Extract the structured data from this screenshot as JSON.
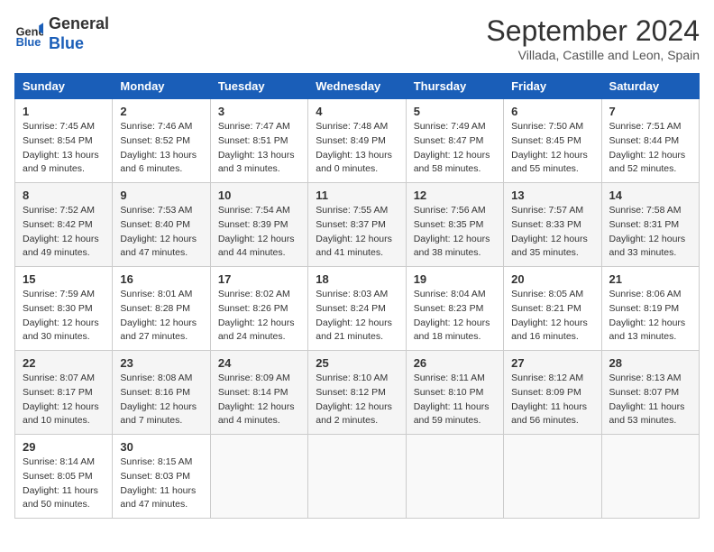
{
  "header": {
    "logo_line1": "General",
    "logo_line2": "Blue",
    "month_title": "September 2024",
    "location": "Villada, Castille and Leon, Spain"
  },
  "weekdays": [
    "Sunday",
    "Monday",
    "Tuesday",
    "Wednesday",
    "Thursday",
    "Friday",
    "Saturday"
  ],
  "weeks": [
    [
      {
        "day": "1",
        "sunrise": "Sunrise: 7:45 AM",
        "sunset": "Sunset: 8:54 PM",
        "daylight": "Daylight: 13 hours and 9 minutes."
      },
      {
        "day": "2",
        "sunrise": "Sunrise: 7:46 AM",
        "sunset": "Sunset: 8:52 PM",
        "daylight": "Daylight: 13 hours and 6 minutes."
      },
      {
        "day": "3",
        "sunrise": "Sunrise: 7:47 AM",
        "sunset": "Sunset: 8:51 PM",
        "daylight": "Daylight: 13 hours and 3 minutes."
      },
      {
        "day": "4",
        "sunrise": "Sunrise: 7:48 AM",
        "sunset": "Sunset: 8:49 PM",
        "daylight": "Daylight: 13 hours and 0 minutes."
      },
      {
        "day": "5",
        "sunrise": "Sunrise: 7:49 AM",
        "sunset": "Sunset: 8:47 PM",
        "daylight": "Daylight: 12 hours and 58 minutes."
      },
      {
        "day": "6",
        "sunrise": "Sunrise: 7:50 AM",
        "sunset": "Sunset: 8:45 PM",
        "daylight": "Daylight: 12 hours and 55 minutes."
      },
      {
        "day": "7",
        "sunrise": "Sunrise: 7:51 AM",
        "sunset": "Sunset: 8:44 PM",
        "daylight": "Daylight: 12 hours and 52 minutes."
      }
    ],
    [
      {
        "day": "8",
        "sunrise": "Sunrise: 7:52 AM",
        "sunset": "Sunset: 8:42 PM",
        "daylight": "Daylight: 12 hours and 49 minutes."
      },
      {
        "day": "9",
        "sunrise": "Sunrise: 7:53 AM",
        "sunset": "Sunset: 8:40 PM",
        "daylight": "Daylight: 12 hours and 47 minutes."
      },
      {
        "day": "10",
        "sunrise": "Sunrise: 7:54 AM",
        "sunset": "Sunset: 8:39 PM",
        "daylight": "Daylight: 12 hours and 44 minutes."
      },
      {
        "day": "11",
        "sunrise": "Sunrise: 7:55 AM",
        "sunset": "Sunset: 8:37 PM",
        "daylight": "Daylight: 12 hours and 41 minutes."
      },
      {
        "day": "12",
        "sunrise": "Sunrise: 7:56 AM",
        "sunset": "Sunset: 8:35 PM",
        "daylight": "Daylight: 12 hours and 38 minutes."
      },
      {
        "day": "13",
        "sunrise": "Sunrise: 7:57 AM",
        "sunset": "Sunset: 8:33 PM",
        "daylight": "Daylight: 12 hours and 35 minutes."
      },
      {
        "day": "14",
        "sunrise": "Sunrise: 7:58 AM",
        "sunset": "Sunset: 8:31 PM",
        "daylight": "Daylight: 12 hours and 33 minutes."
      }
    ],
    [
      {
        "day": "15",
        "sunrise": "Sunrise: 7:59 AM",
        "sunset": "Sunset: 8:30 PM",
        "daylight": "Daylight: 12 hours and 30 minutes."
      },
      {
        "day": "16",
        "sunrise": "Sunrise: 8:01 AM",
        "sunset": "Sunset: 8:28 PM",
        "daylight": "Daylight: 12 hours and 27 minutes."
      },
      {
        "day": "17",
        "sunrise": "Sunrise: 8:02 AM",
        "sunset": "Sunset: 8:26 PM",
        "daylight": "Daylight: 12 hours and 24 minutes."
      },
      {
        "day": "18",
        "sunrise": "Sunrise: 8:03 AM",
        "sunset": "Sunset: 8:24 PM",
        "daylight": "Daylight: 12 hours and 21 minutes."
      },
      {
        "day": "19",
        "sunrise": "Sunrise: 8:04 AM",
        "sunset": "Sunset: 8:23 PM",
        "daylight": "Daylight: 12 hours and 18 minutes."
      },
      {
        "day": "20",
        "sunrise": "Sunrise: 8:05 AM",
        "sunset": "Sunset: 8:21 PM",
        "daylight": "Daylight: 12 hours and 16 minutes."
      },
      {
        "day": "21",
        "sunrise": "Sunrise: 8:06 AM",
        "sunset": "Sunset: 8:19 PM",
        "daylight": "Daylight: 12 hours and 13 minutes."
      }
    ],
    [
      {
        "day": "22",
        "sunrise": "Sunrise: 8:07 AM",
        "sunset": "Sunset: 8:17 PM",
        "daylight": "Daylight: 12 hours and 10 minutes."
      },
      {
        "day": "23",
        "sunrise": "Sunrise: 8:08 AM",
        "sunset": "Sunset: 8:16 PM",
        "daylight": "Daylight: 12 hours and 7 minutes."
      },
      {
        "day": "24",
        "sunrise": "Sunrise: 8:09 AM",
        "sunset": "Sunset: 8:14 PM",
        "daylight": "Daylight: 12 hours and 4 minutes."
      },
      {
        "day": "25",
        "sunrise": "Sunrise: 8:10 AM",
        "sunset": "Sunset: 8:12 PM",
        "daylight": "Daylight: 12 hours and 2 minutes."
      },
      {
        "day": "26",
        "sunrise": "Sunrise: 8:11 AM",
        "sunset": "Sunset: 8:10 PM",
        "daylight": "Daylight: 11 hours and 59 minutes."
      },
      {
        "day": "27",
        "sunrise": "Sunrise: 8:12 AM",
        "sunset": "Sunset: 8:09 PM",
        "daylight": "Daylight: 11 hours and 56 minutes."
      },
      {
        "day": "28",
        "sunrise": "Sunrise: 8:13 AM",
        "sunset": "Sunset: 8:07 PM",
        "daylight": "Daylight: 11 hours and 53 minutes."
      }
    ],
    [
      {
        "day": "29",
        "sunrise": "Sunrise: 8:14 AM",
        "sunset": "Sunset: 8:05 PM",
        "daylight": "Daylight: 11 hours and 50 minutes."
      },
      {
        "day": "30",
        "sunrise": "Sunrise: 8:15 AM",
        "sunset": "Sunset: 8:03 PM",
        "daylight": "Daylight: 11 hours and 47 minutes."
      },
      null,
      null,
      null,
      null,
      null
    ]
  ]
}
